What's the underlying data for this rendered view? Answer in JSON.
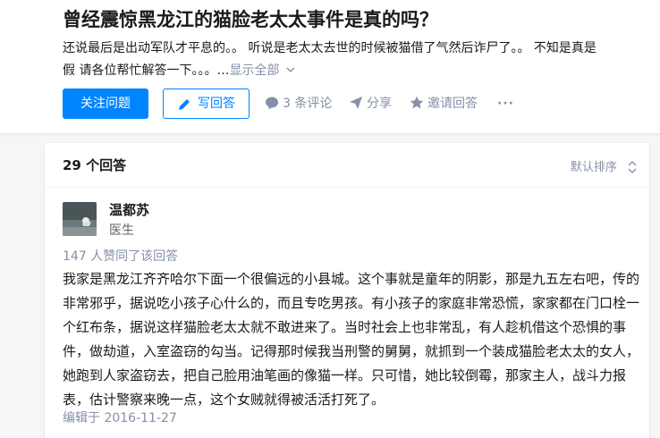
{
  "question": {
    "title": "曾经震惊黑龙江的猫脸老太太事件是真的吗？",
    "detail_lines": [
      "还说最后是出动军队才平息的。。 听说是老太太去世的时候被猫借了气然后诈尸了。。 不知是真是",
      "假 请各位帮忙解答一下。。。…"
    ],
    "show_all": "显示全部",
    "actions": {
      "follow": "关注问题",
      "write_answer": "写回答",
      "comments": "3 条评论",
      "share": "分享",
      "invite": "邀请回答",
      "more": "···"
    }
  },
  "answers": {
    "count_label": "29 个回答",
    "sort_label": "默认排序",
    "first": {
      "author_name": "温都苏",
      "author_bio": "医生",
      "votes_label": "147 人赞同了该回答",
      "content_lines": [
        "我家是黑龙江齐齐哈尔下面一个很偏远的小县城。这个事就是童年的阴影，那是九五左右吧，传的",
        "非常邪乎，据说吃小孩子心什么的，而且专吃男孩。有小孩子的家庭非常恐慌，家家都在门口栓一",
        "个红布条，据说这样猫脸老太太就不敢进来了。当时社会上也非常乱，有人趁机借这个恐惧的事",
        "件，做劫道，入室盗窃的勾当。记得那时候我当刑警的舅舅，就抓到一个装成猫脸老太太的女人，",
        "她跑到人家盗窃去，把自己脸用油笔画的像猫一样。只可惜，她比较倒霉，那家主人，战斗力报",
        "表，估计警察来晚一点，这个女贼就得被活活打死了。"
      ],
      "edited_label": "编辑于 2016-11-27"
    }
  },
  "colors": {
    "accent": "#0084ff",
    "muted": "#8590a6",
    "page_bg": "#f6f6f6"
  }
}
